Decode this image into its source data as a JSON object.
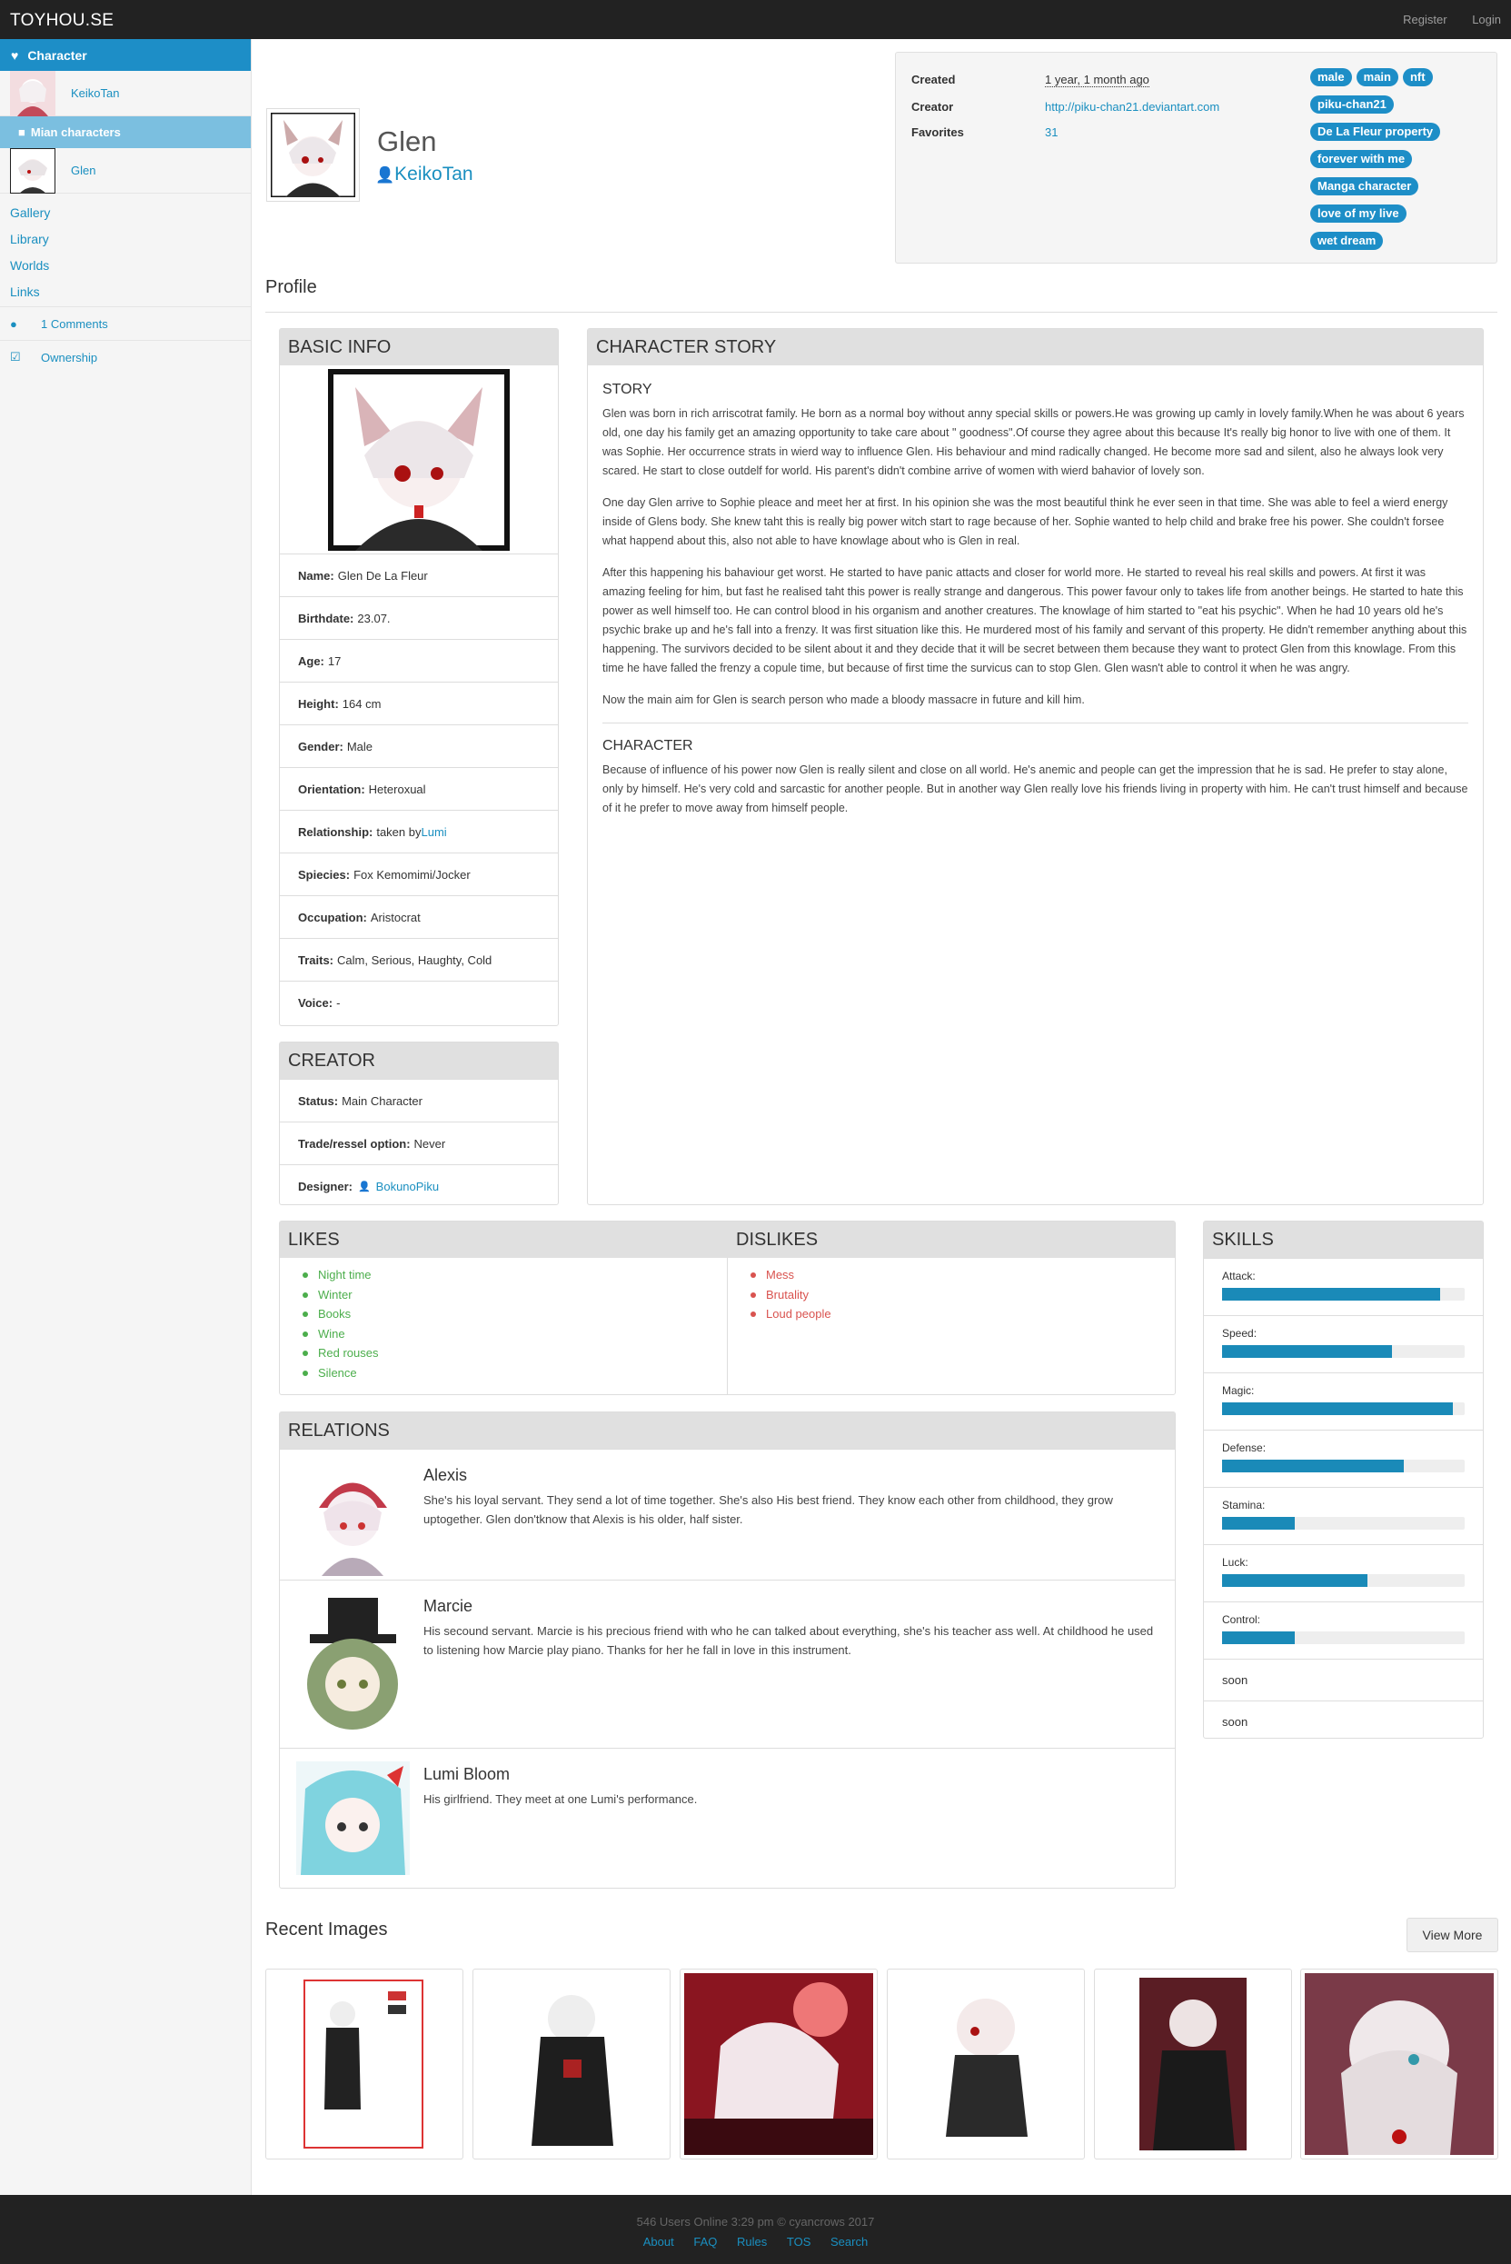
{
  "nav": {
    "brand": "TOYHOU.SE",
    "register": "Register",
    "login": "Login"
  },
  "sidebar": {
    "header": "Character",
    "owner_name": "KeikoTan",
    "folder": "Mian characters",
    "char_name": "Glen",
    "links": [
      "Gallery",
      "Library",
      "Worlds",
      "Links"
    ],
    "comments": "1 Comments",
    "ownership": "Ownership"
  },
  "character": {
    "name": "Glen",
    "owner": "KeikoTan"
  },
  "meta": {
    "created_label": "Created",
    "created_value": "1 year, 1 month ago",
    "creator_label": "Creator",
    "creator_value": "http://piku-chan21.deviantart.com",
    "favorites_label": "Favorites",
    "favorites_value": "31",
    "tags": [
      "male",
      "main",
      "nft",
      "piku-chan21",
      "De La Fleur property",
      "forever with me",
      "Manga character",
      "love of my live",
      "wet dream"
    ]
  },
  "profile_title": "Profile",
  "basic_info": {
    "title": "BASIC INFO",
    "rows": [
      {
        "k": "Name:",
        "v": "Glen De La Fleur"
      },
      {
        "k": "Birthdate:",
        "v": "23.07."
      },
      {
        "k": "Age:",
        "v": "17"
      },
      {
        "k": "Height:",
        "v": "164 cm"
      },
      {
        "k": "Gender:",
        "v": "Male"
      },
      {
        "k": "Orientation:",
        "v": "Heteroxual"
      },
      {
        "k": "Relationship:",
        "v": "taken by",
        "link": "Lumi"
      },
      {
        "k": "Spiecies:",
        "v": "Fox Kemomimi/Jocker"
      },
      {
        "k": "Occupation:",
        "v": "Aristocrat"
      },
      {
        "k": "Traits:",
        "v": "Calm, Serious, Haughty, Cold"
      },
      {
        "k": "Voice:",
        "v": "-"
      }
    ]
  },
  "creator_panel": {
    "title": "CREATOR",
    "rows": [
      {
        "k": "Status:",
        "v": "Main Character"
      },
      {
        "k": "Trade/ressel option:",
        "v": "Never"
      },
      {
        "k": "Designer:",
        "v": "",
        "link": "BokunoPiku"
      }
    ]
  },
  "story": {
    "title": "CHARACTER STORY",
    "story_heading": "STORY",
    "paragraphs": [
      "Glen was born in rich arriscotrat family. He born as a normal boy without anny special skills or powers.He was growing up camly in lovely family.When he was about 6 years old, one day his family get an amazing opportunity to take care about \" goodness\".Of course they agree about this because It's really big honor to live with one of them. It was Sophie. Her occurrence strats in wierd way to influence Glen. His behaviour and mind radically changed. He become more sad and silent, also he always look very scared. He start to close outdelf for world. His parent's didn't combine arrive of women with wierd bahavior of lovely son.",
      "One day Glen arrive to Sophie pleace and meet her at first. In his opinion she was the most beautiful think he ever seen in that time. She was able to feel a wierd energy inside of Glens body. She knew taht this is really big power witch start to rage because of her. Sophie wanted to help child and brake free his power. She couldn't forsee what happend about this, also not able to have knowlage about who is Glen in real.",
      "After this happening his bahaviour get worst. He started to have panic attacts and closer for world more. He started to reveal his real skills and powers. At first it was amazing feeling for him, but fast he realised taht this power is really strange and dangerous. This power favour only to takes life from another beings. He started to hate this power as well himself too. He can control blood in his organism and another creatures. The knowlage of him started to \"eat his psychic\". When he had 10 years old he's psychic brake up and he's fall into a frenzy. It was first situation like this. He murdered most of his family and servant of this property. He didn't remember anything about this happening. The survivors decided to be silent about it and they decide that it will be secret between them because they want to protect Glen from this knowlage. From this time he have falled the frenzy a copule time, but because of first time the survicus can to stop Glen. Glen wasn't able to control it when he was angry.",
      "Now the main aim for Glen is search person who made a bloody massacre in future and kill him."
    ],
    "character_heading": "CHARACTER",
    "character_text": "Because of influence of his power now Glen is really silent and close on all world. He's anemic and people can get the impression that he is sad. He prefer to stay alone, only by himself. He's very cold and sarcastic for another people. But in another way Glen really love his friends living in property with him. He can't trust himself and because of it he prefer to move away from himself people."
  },
  "likes": {
    "title": "LIKES",
    "items": [
      "Night time",
      "Winter",
      "Books",
      "Wine",
      "Red rouses",
      "Silence"
    ]
  },
  "dislikes": {
    "title": "DISLIKES",
    "items": [
      "Mess",
      "Brutality",
      "Loud people"
    ]
  },
  "skills": {
    "title": "SKILLS",
    "items": [
      {
        "name": "Attack:",
        "value": 90
      },
      {
        "name": "Speed:",
        "value": 70
      },
      {
        "name": "Magic:",
        "value": 95
      },
      {
        "name": "Defense:",
        "value": 75
      },
      {
        "name": "Stamina:",
        "value": 30
      },
      {
        "name": "Luck:",
        "value": 60
      },
      {
        "name": "Control:",
        "value": 30
      }
    ],
    "soon": [
      "soon",
      "soon"
    ]
  },
  "relations": {
    "title": "RELATIONS",
    "items": [
      {
        "name": "Alexis",
        "text": "She's his loyal servant. They send a lot of time together. She's also His best friend. They know each other from childhood, they grow uptogether. Glen don'tknow that Alexis is his older, half sister."
      },
      {
        "name": "Marcie",
        "text": "His secound servant. Marcie is his precious friend with who he can talked about everything, she's his teacher ass well. At childhood he used to listening how Marcie play piano. Thanks for her he fall in love in this instrument."
      },
      {
        "name": "Lumi Bloom",
        "text": "His girlfriend. They meet at one Lumi's performance."
      }
    ]
  },
  "recent": {
    "title": "Recent Images",
    "view_more": "View More"
  },
  "footer": {
    "line1": "546 Users Online   3:29 pm   © cyancrows 2017",
    "links": [
      "About",
      "FAQ",
      "Rules",
      "TOS",
      "Search"
    ]
  },
  "colors": {
    "accent": "#1d8ec7",
    "likes": "#4cae4c",
    "dislikes": "#d9534f",
    "skill_bar": "#1a8ab8"
  }
}
